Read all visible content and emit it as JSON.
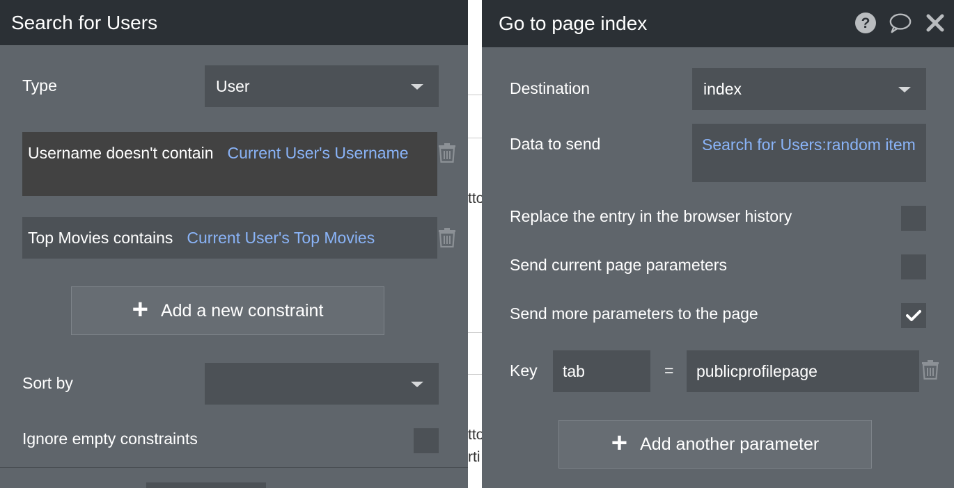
{
  "left_panel": {
    "title": "Search for Users",
    "type_label": "Type",
    "type_value": "User",
    "constraints": [
      {
        "text": "Username doesn't contain",
        "dynamic": "Current User's Username"
      },
      {
        "text": "Top Movies contains",
        "dynamic": "Current User's Top Movies"
      }
    ],
    "add_constraint_label": "Add a new constraint",
    "sort_by_label": "Sort by",
    "sort_by_value": "",
    "ignore_empty_label": "Ignore empty constraints"
  },
  "canvas_snippets": [
    "tto",
    "tto",
    "rti"
  ],
  "right_panel": {
    "title": "Go to page index",
    "header_icons": [
      "help-icon",
      "comment-icon",
      "close-icon"
    ],
    "destination_label": "Destination",
    "destination_value": "index",
    "data_to_send_label": "Data to send",
    "data_to_send_value": "Search for Users:random item",
    "replace_history_label": "Replace the entry in the browser history",
    "replace_history_checked": false,
    "send_current_params_label": "Send current page parameters",
    "send_current_params_checked": false,
    "send_more_params_label": "Send more parameters to the page",
    "send_more_params_checked": true,
    "param": {
      "key_label": "Key",
      "key_value": "tab",
      "equals": "=",
      "value": "publicprofilepage"
    },
    "add_parameter_label": "Add another parameter"
  },
  "colors": {
    "panel_bg": "#5f656b",
    "header_bg": "#2b3035",
    "field_bg": "#4c5156",
    "dynamic_text": "#8ab4f8"
  }
}
